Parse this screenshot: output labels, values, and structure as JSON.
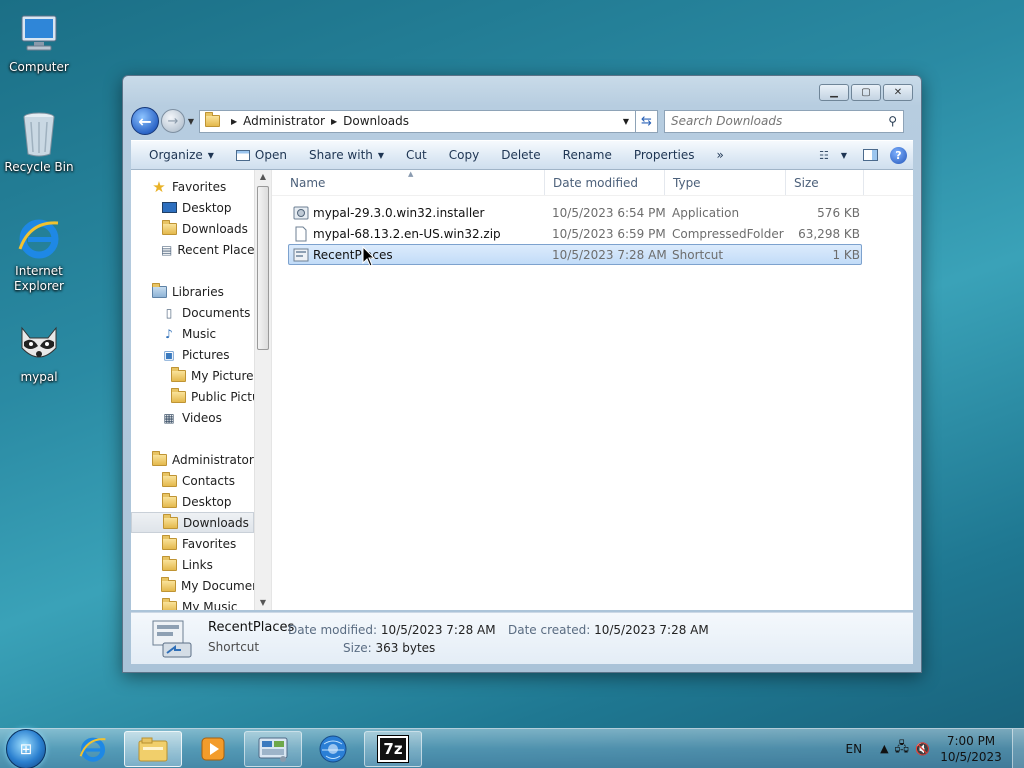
{
  "desktop": {
    "icons": [
      {
        "label": "Computer"
      },
      {
        "label": "Recycle Bin"
      },
      {
        "label": "Internet Explorer"
      },
      {
        "label": "mypal"
      }
    ]
  },
  "window": {
    "controls": {
      "minimize": "minimize-icon",
      "maximize": "maximize-icon",
      "close": "close-icon"
    },
    "address": {
      "crumbs": [
        "Administrator",
        "Downloads"
      ]
    },
    "search": {
      "placeholder": "Search Downloads"
    },
    "toolbar": {
      "organize": "Organize",
      "open": "Open",
      "share_with": "Share with",
      "cut": "Cut",
      "copy": "Copy",
      "delete": "Delete",
      "rename": "Rename",
      "properties": "Properties",
      "more": "»"
    },
    "nav_pane": {
      "favorites": {
        "label": "Favorites",
        "items": [
          "Desktop",
          "Downloads",
          "Recent Places"
        ]
      },
      "libraries": {
        "label": "Libraries",
        "items": [
          "Documents",
          "Music",
          "Pictures",
          "My Pictures",
          "Public Pictures",
          "Videos"
        ]
      },
      "user": {
        "label": "Administrator",
        "items": [
          "Contacts",
          "Desktop",
          "Downloads",
          "Favorites",
          "Links",
          "My Documents",
          "My Music"
        ]
      }
    },
    "columns": {
      "name": "Name",
      "date": "Date modified",
      "type": "Type",
      "size": "Size"
    },
    "files": [
      {
        "name": "mypal-29.3.0.win32.installer",
        "date": "10/5/2023 6:54 PM",
        "type": "Application",
        "size": "576 KB"
      },
      {
        "name": "mypal-68.13.2.en-US.win32.zip",
        "date": "10/5/2023 6:59 PM",
        "type": "CompressedFolder",
        "size": "63,298 KB"
      },
      {
        "name": "RecentPlaces",
        "date": "10/5/2023 7:28 AM",
        "type": "Shortcut",
        "size": "1 KB"
      }
    ],
    "details": {
      "name": "RecentPlaces",
      "type": "Shortcut",
      "date_modified_label": "Date modified:",
      "date_modified": "10/5/2023 7:28 AM",
      "date_created_label": "Date created:",
      "date_created": "10/5/2023 7:28 AM",
      "size_label": "Size:",
      "size": "363 bytes"
    }
  },
  "taskbar": {
    "lang": "EN",
    "time": "7:00 PM",
    "date": "10/5/2023",
    "apps": [
      "internet-explorer-icon",
      "explorer-icon",
      "media-player-icon",
      "control-panel-icon",
      "mypal-globe-icon",
      "7zip-icon"
    ],
    "seven_zip_label": "7z"
  }
}
